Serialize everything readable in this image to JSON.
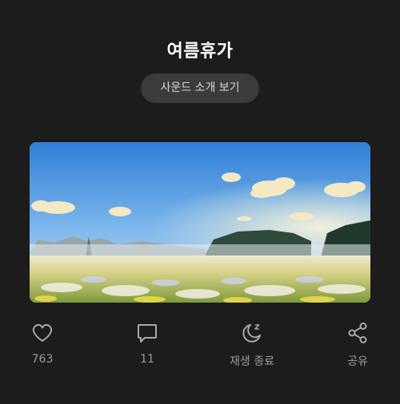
{
  "header": {
    "title": "여름휴가",
    "sound_intro_button": "사운드 소개 보기"
  },
  "actions": {
    "like": {
      "icon": "heart-icon",
      "count": "763"
    },
    "comment": {
      "icon": "comment-icon",
      "count": "11"
    },
    "sleep_timer": {
      "icon": "moon-sleep-icon",
      "label": "재생 종료"
    },
    "share": {
      "icon": "share-icon",
      "label": "공유"
    }
  },
  "colors": {
    "background": "#1c1c1c",
    "button_bg": "#3b3b3b",
    "muted_text": "#9b9b9b",
    "icon": "#a8a8a8"
  }
}
